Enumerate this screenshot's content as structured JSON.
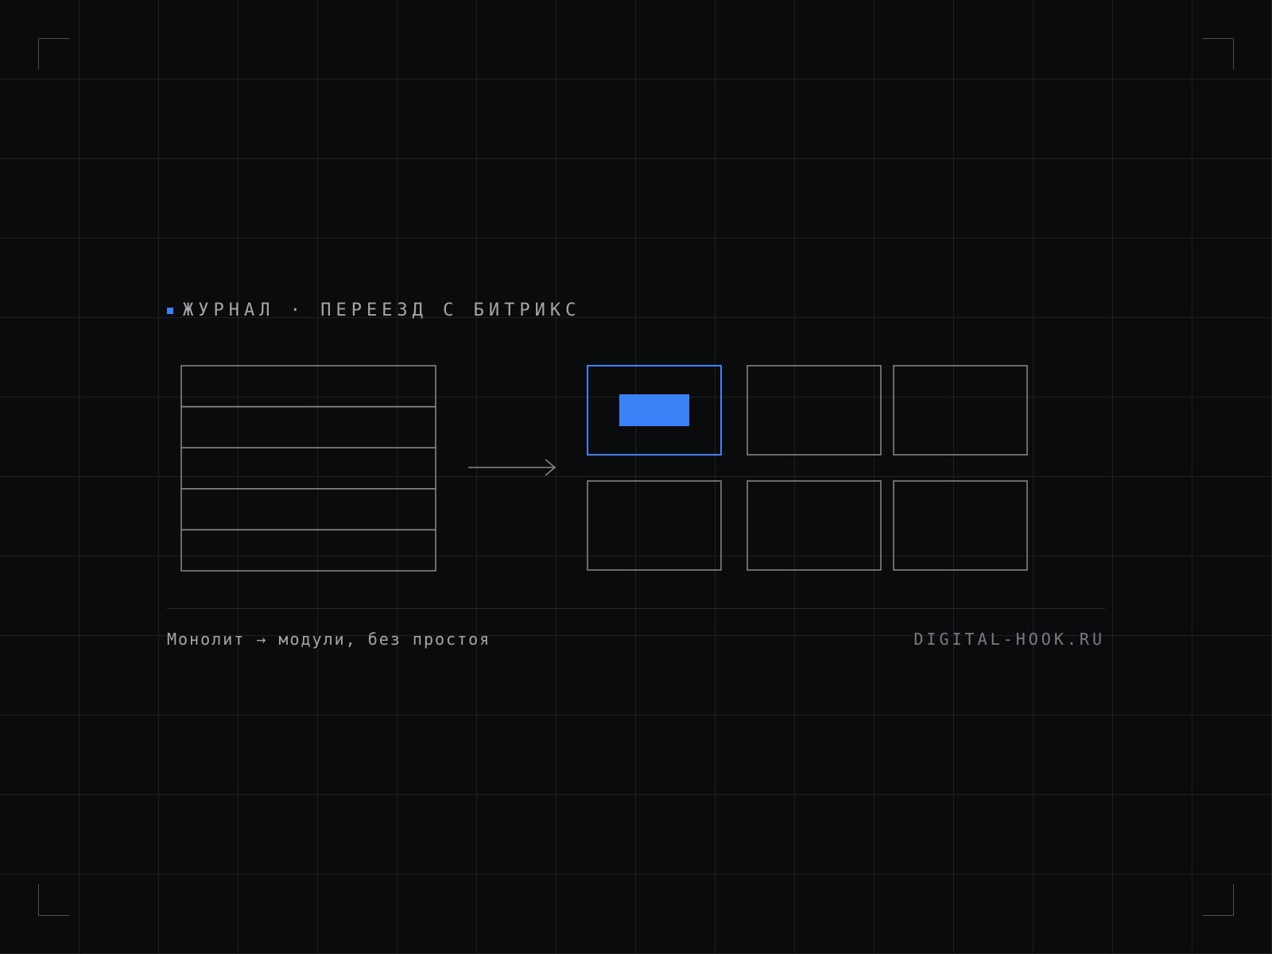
{
  "header": {
    "kicker": "ЖУРНАЛ · ПЕРЕЕЗД С БИТРИКС"
  },
  "footer": {
    "caption": "Монолит → модули, без простоя",
    "domain": "DIGITAL-HOOK.RU"
  },
  "diagram": {
    "monolith_rows": 5,
    "module_grid": {
      "rows": 2,
      "cols": 3,
      "highlighted_index": 0
    }
  },
  "colors": {
    "background": "#0a0b0d",
    "grid": "#1e2023",
    "stroke": "#8a8a8a",
    "accent": "#3b82f6",
    "text": "#a6a6a6",
    "muted_text": "#7a7c80"
  }
}
